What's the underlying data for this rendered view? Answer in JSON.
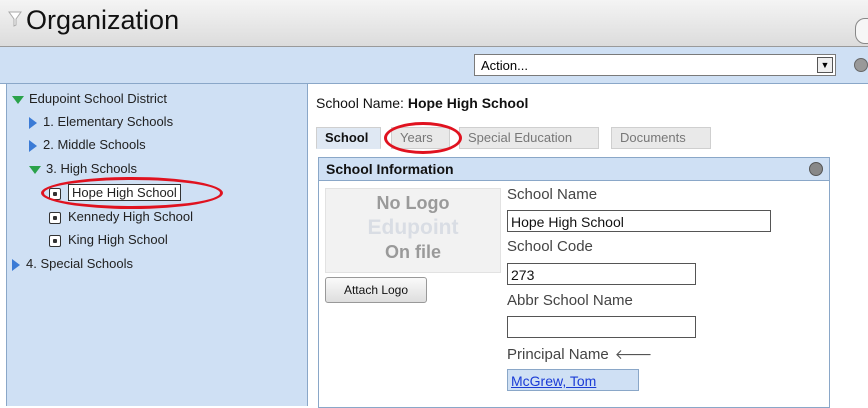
{
  "window": {
    "title": "Organization"
  },
  "action_bar": {
    "select_value": "Action..."
  },
  "tree": {
    "root": "Edupoint School District",
    "items": [
      {
        "label": "1. Elementary Schools"
      },
      {
        "label": "2. Middle Schools"
      },
      {
        "label": "3. High Schools"
      },
      {
        "label": "Hope High School"
      },
      {
        "label": "Kennedy High School"
      },
      {
        "label": "King High School"
      },
      {
        "label": "4. Special Schools"
      }
    ]
  },
  "header": {
    "school_name_label": "School Name:",
    "school_name_value": "Hope High School"
  },
  "tabs": [
    {
      "label": "School"
    },
    {
      "label": "Years"
    },
    {
      "label": "Special Education"
    },
    {
      "label": "Documents"
    }
  ],
  "panel": {
    "title": "School Information",
    "logo_text": [
      "No Logo",
      "Edupoint",
      "On file"
    ],
    "attach_button": "Attach Logo",
    "fields": {
      "school_name": {
        "label": "School Name",
        "value": "Hope High School"
      },
      "school_code": {
        "label": "School Code",
        "value": "273"
      },
      "abbr_school_name": {
        "label": "Abbr School Name",
        "value": ""
      },
      "principal_name": {
        "label": "Principal Name",
        "value": "McGrew, Tom"
      }
    }
  },
  "colors": {
    "pane_blue": "#cfe0f4",
    "highlight_red": "#e0121f",
    "link_blue": "#1a3bd6",
    "expand_green": "#2aa24a"
  }
}
